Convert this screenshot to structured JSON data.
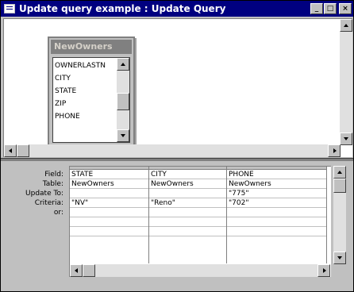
{
  "window": {
    "title": "Update query example : Update Query",
    "buttons": {
      "minimize": "_",
      "maximize": "□",
      "close": "×"
    }
  },
  "field_list": {
    "title": "NewOwners",
    "items": [
      "OWNERLASTN",
      "CITY",
      "STATE",
      "ZIP",
      "PHONE"
    ]
  },
  "grid": {
    "row_labels": [
      "Field:",
      "Table:",
      "Update To:",
      "Criteria:",
      "or:"
    ],
    "columns": [
      {
        "field": "STATE",
        "table": "NewOwners",
        "update_to": "",
        "criteria": "\"NV\""
      },
      {
        "field": "CITY",
        "table": "NewOwners",
        "update_to": "",
        "criteria": "\"Reno\""
      },
      {
        "field": "PHONE",
        "table": "NewOwners",
        "update_to": "\"775\"",
        "criteria": "\"702\""
      }
    ]
  },
  "colors": {
    "titlebar": "#000080",
    "face": "#c0c0c0",
    "window": "#ffffff"
  }
}
